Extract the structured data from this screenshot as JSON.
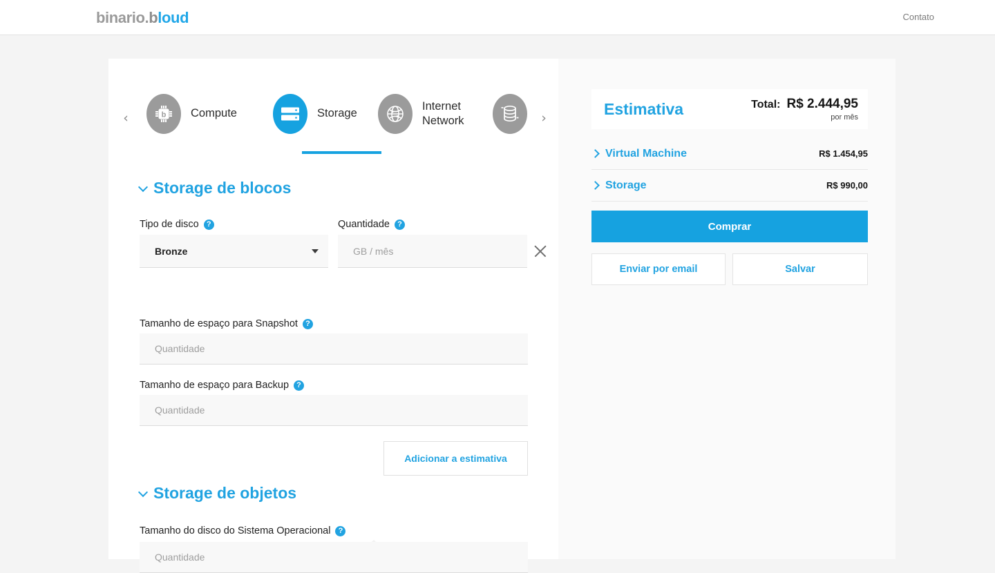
{
  "header": {
    "logo_prefix": "binario.",
    "logo_mark": "b",
    "logo_suffix": "loud",
    "contact_label": "Contato"
  },
  "tabs": {
    "prev_arrow": "‹",
    "next_arrow": "›",
    "items": [
      {
        "label": "Compute",
        "icon": "cpu-chip-icon",
        "active": false
      },
      {
        "label": "Storage",
        "icon": "server-rack-icon",
        "active": true
      },
      {
        "label": "Internet\nNetwork",
        "icon": "globe-icon",
        "active": false
      },
      {
        "label": "",
        "icon": "database-icon",
        "active": false
      }
    ]
  },
  "block_storage": {
    "title": "Storage de blocos",
    "disk_type_label": "Tipo de disco",
    "disk_type_value": "Bronze",
    "quantity_label": "Quantidade",
    "quantity_placeholder": "GB / mês",
    "quantity_value": "",
    "add_label": "Adicionar",
    "snapshot_label": "Tamanho de espaço para Snapshot",
    "snapshot_placeholder": "Quantidade",
    "snapshot_value": "",
    "backup_label": "Tamanho de espaço para Backup",
    "backup_placeholder": "Quantidade",
    "backup_value": "",
    "add_estimate_label": "Adicionar a estimativa",
    "help_glyph": "?"
  },
  "object_storage": {
    "title": "Storage de objetos",
    "os_disk_label": "Tamanho do disco do Sistema Operacional",
    "os_disk_placeholder": "Quantidade",
    "os_disk_value": "",
    "help_glyph": "?"
  },
  "estimate": {
    "title": "Estimativa",
    "total_label": "Total:",
    "total_value": "R$ 2.444,95",
    "per_month": "por mês",
    "rows": [
      {
        "name": "Virtual Machine",
        "value": "R$ 1.454,95"
      },
      {
        "name": "Storage",
        "value": "R$ 990,00"
      }
    ],
    "buy_label": "Comprar",
    "email_label": "Enviar por email",
    "save_label": "Salvar"
  },
  "colors": {
    "accent": "#21a3e1",
    "accent_solid": "#16a2e0",
    "page_bg": "#f4f4f4",
    "panel_bg": "#fafafa",
    "input_bg": "#f8f8f8",
    "icon_grey": "#9b9b9b"
  }
}
